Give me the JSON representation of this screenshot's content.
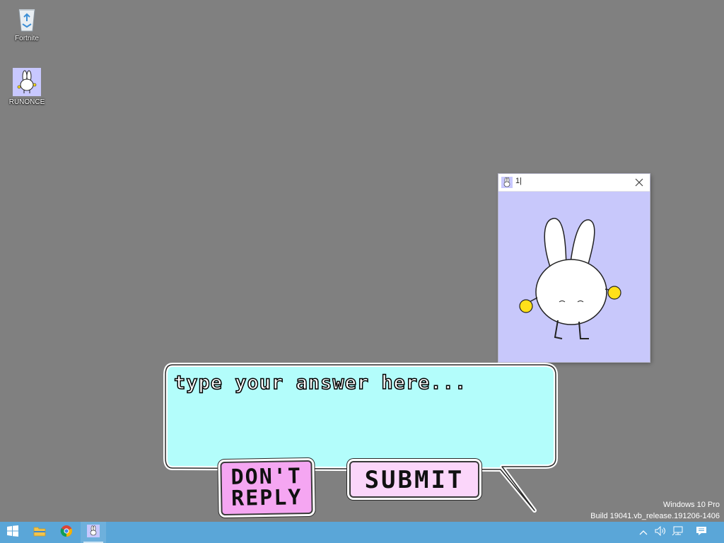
{
  "desktop": {
    "icons": [
      {
        "label": "Fortnite"
      },
      {
        "label": "RUNONCE"
      }
    ]
  },
  "mini_window": {
    "title": "1|"
  },
  "dialog": {
    "placeholder": "type your answer here...",
    "dont_reply_line1": "DON'T",
    "dont_reply_line2": "REPLY",
    "submit_label": "SUBMIT"
  },
  "watermark": {
    "line1": "Windows 10 Pro",
    "line2": "Build 19041.vb_release.191206-1406"
  },
  "colors": {
    "desktop": "#808080",
    "bubble": "#b3fdfb",
    "window_bg": "#c8c8fb",
    "taskbar": "#5aa6d8",
    "dont_reply": "#f5a6f2",
    "submit": "#fbd6fa"
  },
  "taskbar": {
    "items": [
      "start-icon",
      "file-explorer-icon",
      "chrome-icon",
      "runonce-icon"
    ],
    "tray": [
      "chevron-up-icon",
      "volume-icon",
      "network-icon",
      "notification-icon"
    ]
  }
}
